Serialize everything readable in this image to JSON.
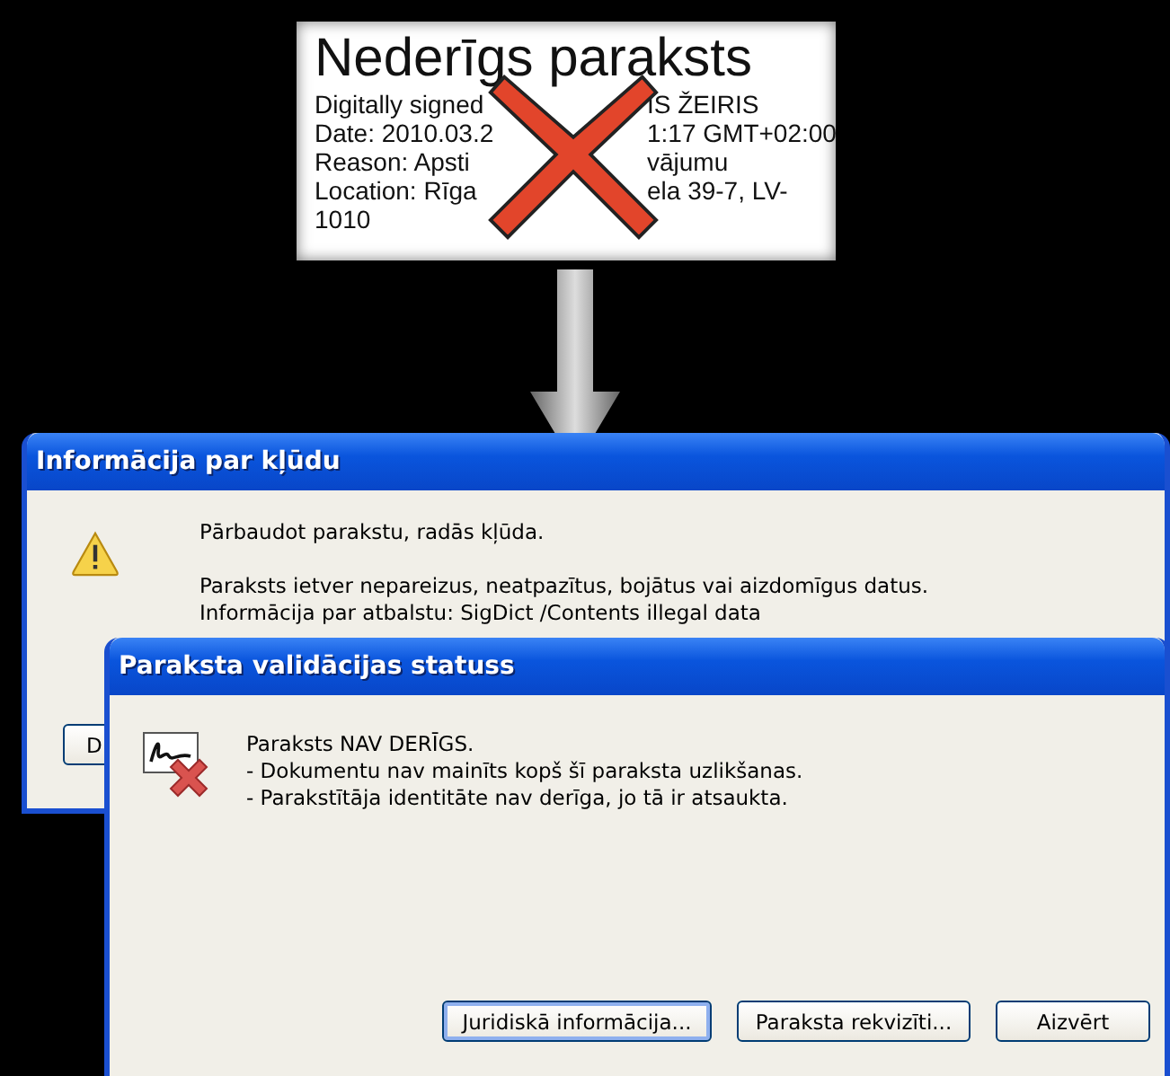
{
  "signature_image": {
    "title": "Nederīgs paraksts",
    "lines": [
      [
        "Digitally signed",
        "IS ŽEIRIS"
      ],
      [
        "Date: 2010.03.2",
        "1:17 GMT+02:00"
      ],
      [
        "Reason: Apsti",
        "vājumu"
      ],
      [
        "Location: Rīga",
        "ela 39-7, LV-"
      ],
      [
        "1010"
      ]
    ]
  },
  "error_dialog": {
    "title": "Informācija par kļūdu",
    "message": "Pārbaudot parakstu, radās kļūda.",
    "details": [
      "Paraksts ietver nepareizus, neatpazītus, bojātus vai aizdomīgus datus.",
      "Informācija par atbalstu: SigDict /Contents illegal data"
    ],
    "button": "D"
  },
  "status_dialog": {
    "title": "Paraksta validācijas statuss",
    "lines": [
      "Paraksts NAV DERĪGS.",
      "- Dokumentu nav mainīts kopš šī paraksta uzlikšanas.",
      "- Parakstītāja identitāte nav derīga, jo tā ir atsaukta."
    ],
    "buttons": [
      {
        "label": "Juridiskā informācija...",
        "selected": true
      },
      {
        "label": "Paraksta rekvizīti...",
        "selected": false
      },
      {
        "label": "Aizvērt",
        "selected": false
      }
    ]
  }
}
